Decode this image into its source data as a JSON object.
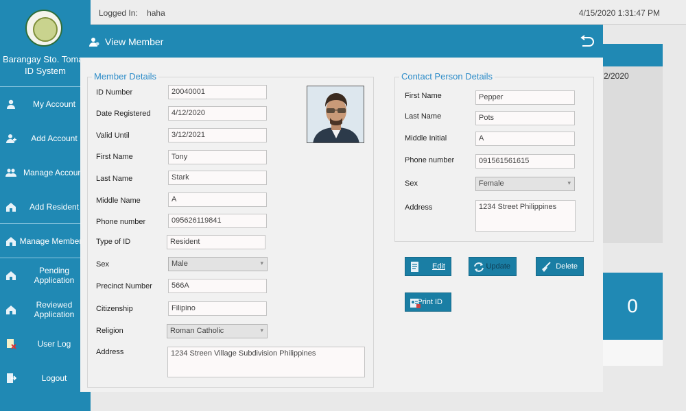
{
  "app": {
    "brand_line1": "Barangay Sto. Tomas",
    "brand_line2": "ID System",
    "accent": "#2089b4"
  },
  "topbar": {
    "logged_in_label": "Logged In:",
    "username": "haha",
    "datetime": "4/15/2020 1:31:47 PM"
  },
  "sidebar": {
    "items": [
      {
        "label": "My Account",
        "icon": "user-icon"
      },
      {
        "label": "Add Account",
        "icon": "add-user-icon"
      },
      {
        "label": "Manage Accounts",
        "icon": "users-icon"
      },
      {
        "label": "Add Resident",
        "icon": "house-icon"
      },
      {
        "label": "Manage Members",
        "icon": "house-icon"
      },
      {
        "label": "Pending Application",
        "icon": "house-icon"
      },
      {
        "label": "Reviewed Application",
        "icon": "house-icon"
      },
      {
        "label": "User Log",
        "icon": "user-log-icon"
      },
      {
        "label": "Logout",
        "icon": "logout-icon"
      }
    ]
  },
  "background": {
    "date_fragment": "2/2020",
    "count": "0"
  },
  "dialog": {
    "title": "View Member",
    "member_details": {
      "legend": "Member Details",
      "id_number_label": "ID Number",
      "id_number": "20040001",
      "date_registered_label": "Date Registered",
      "date_registered": "4/12/2020",
      "valid_until_label": "Valid Until",
      "valid_until": "3/12/2021",
      "first_name_label": "First Name",
      "first_name": "Tony",
      "last_name_label": "Last Name",
      "last_name": "Stark",
      "middle_name_label": "Middle Name",
      "middle_name": "A",
      "phone_label": "Phone number",
      "phone": "095626119841",
      "type_id_label": "Type of ID",
      "type_id": "Resident",
      "sex_label": "Sex",
      "sex": "Male",
      "precinct_label": "Precinct Number",
      "precinct": "566A",
      "citizenship_label": "Citizenship",
      "citizenship": "Filipino",
      "religion_label": "Religion",
      "religion": "Roman Catholic",
      "address_label": "Address",
      "address": "1234 Streen Village Subdivision Philippines"
    },
    "contact_details": {
      "legend": "Contact Person Details",
      "first_name_label": "First Name",
      "first_name": "Pepper",
      "last_name_label": "Last Name",
      "last_name": "Pots",
      "middle_initial_label": "Middle Initial",
      "middle_initial": "A",
      "phone_label": "Phone number",
      "phone": "091561561615",
      "sex_label": "Sex",
      "sex": "Female",
      "address_label": "Address",
      "address": "1234 Street Philippines"
    },
    "buttons": {
      "edit": "Edit",
      "update": "Update",
      "delete": "Delete",
      "print_id": "Print ID"
    }
  }
}
